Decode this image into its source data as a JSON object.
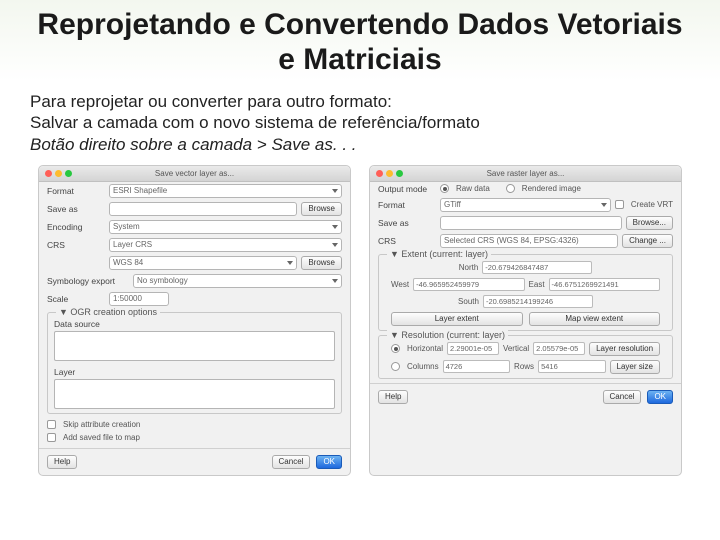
{
  "title": "Reprojetando e Convertendo Dados Vetoriais e Matriciais",
  "body": {
    "line1": "Para reprojetar ou converter para outro formato:",
    "line2": "Salvar a camada com o novo sistema de referência/formato",
    "line3": "Botão direito sobre a camada > Save as. . ."
  },
  "left": {
    "win_title": "Save vector layer as...",
    "format_lbl": "Format",
    "format_val": "ESRI Shapefile",
    "saveas_lbl": "Save as",
    "saveas_val": "",
    "browse": "Browse",
    "encoding_lbl": "Encoding",
    "encoding_val": "System",
    "crs_lbl": "CRS",
    "crs_mode": "Layer CRS",
    "crs_val": "WGS 84",
    "sym_lbl": "Symbology export",
    "sym_val": "No symbology",
    "scale_lbl": "Scale",
    "scale_val": "1:50000",
    "ogr_group": "OGR creation options",
    "ds_lbl": "Data source",
    "layer_lbl": "Layer",
    "skip_attr": "Skip attribute creation",
    "add_saved": "Add saved file to map",
    "help": "Help",
    "cancel": "Cancel",
    "ok": "OK"
  },
  "right": {
    "win_title": "Save raster layer as...",
    "output_lbl": "Output mode",
    "raw": "Raw data",
    "rendered": "Rendered image",
    "format_lbl": "Format",
    "format_val": "GTiff",
    "create_vrt": "Create VRT",
    "saveas_lbl": "Save as",
    "saveas_val": "",
    "browse": "Browse...",
    "crs_lbl": "CRS",
    "crs_val": "Selected CRS (WGS 84, EPSG:4326)",
    "change": "Change ...",
    "extent_group": "Extent (current: layer)",
    "north_lbl": "North",
    "north_val": "-20.679426847487",
    "west_lbl": "West",
    "west_val": "-46.965952459979",
    "east_lbl": "East",
    "east_val": "-46.6751269921491",
    "south_lbl": "South",
    "south_val": "-20.6985214199246",
    "layer_extent": "Layer extent",
    "map_extent": "Map view extent",
    "res_group": "Resolution (current: layer)",
    "horiz_lbl": "Horizontal",
    "horiz_val": "2.29001e-05",
    "vert_lbl": "Vertical",
    "vert_val": "2.05579e-05",
    "layer_res": "Layer resolution",
    "cols_lbl": "Columns",
    "cols_val": "4726",
    "rows_lbl": "Rows",
    "rows_val": "5416",
    "layer_size": "Layer size",
    "help": "Help",
    "cancel": "Cancel",
    "ok": "OK"
  }
}
